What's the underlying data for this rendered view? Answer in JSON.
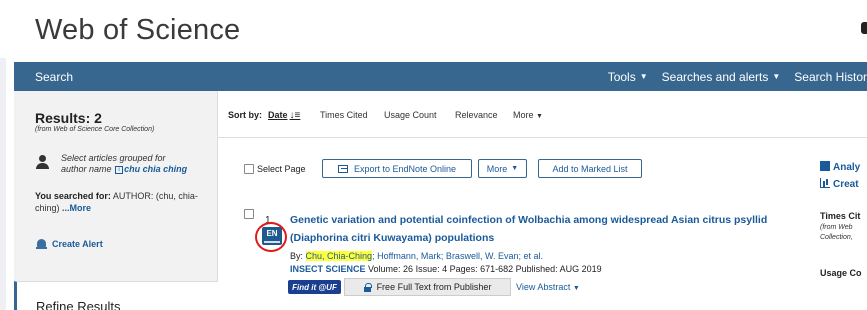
{
  "app": {
    "title": "Web of Science"
  },
  "navbar": {
    "search": "Search",
    "tools": "Tools",
    "searches_alerts": "Searches and alerts",
    "search_history": "Search Histor"
  },
  "sidebar": {
    "results_label": "Results: 2",
    "results_source": "(from Web of Science Core Collection)",
    "group_line1": "Select articles grouped for",
    "group_prefix": "author name",
    "group_author": "chu chia ching",
    "searched_prefix": "You searched for:",
    "searched_query": "AUTHOR: (chu, chia-ching)",
    "searched_more": "...More",
    "create_alert": "Create Alert",
    "refine": "Refine Results"
  },
  "sortbar": {
    "label": "Sort by:",
    "options": [
      "Date",
      "Times Cited",
      "Usage Count",
      "Relevance",
      "More"
    ]
  },
  "toolbar": {
    "select_page": "Select Page",
    "export": "Export to EndNote Online",
    "more": "More",
    "add_marked": "Add to Marked List"
  },
  "result": {
    "number": "1.",
    "title": "Genetic variation and potential coinfection of Wolbachia among widespread Asian citrus psyllid (Diaphorina citri Kuwayama) populations",
    "language_badge": "EN",
    "authors_prefix": "By:",
    "author_highlight": "Chu, Chia-Ching",
    "authors_rest": "; Hoffmann, Mark; Braswell, W. Evan; et al.",
    "journal": "INSECT SCIENCE",
    "source_details": "Volume: 26  Issue: 4  Pages: 671-682  Published: AUG 2019",
    "findit": "Find it @UF",
    "full_text": "Free Full Text from Publisher",
    "view_abstract": "View Abstract"
  },
  "rightpanel": {
    "analyze": "Analy",
    "create": "Creat",
    "times_cited": "Times Cit",
    "tc_line1": "(from Web",
    "tc_line2": "Collection,",
    "usage_count": "Usage Co"
  },
  "colors": {
    "navbar": "#37678f",
    "link": "#1a5a9a",
    "highlight": "#ffff3a",
    "annotation": "#e01a1a"
  }
}
